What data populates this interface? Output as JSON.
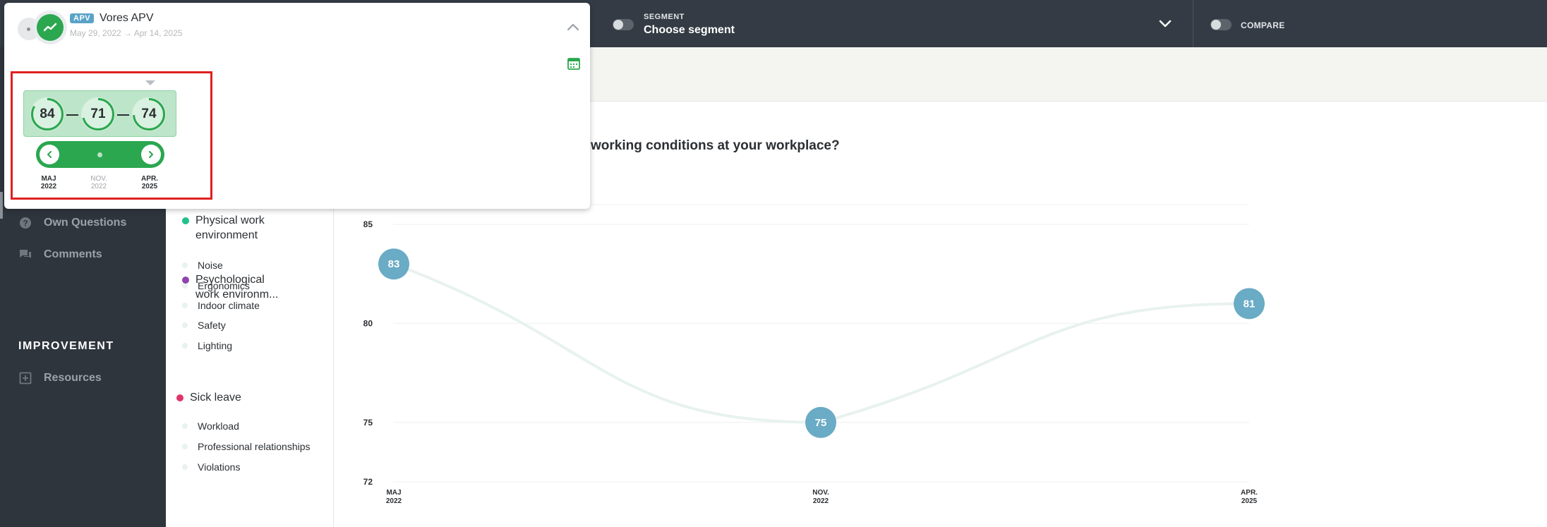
{
  "topbar": {
    "segment_label": "SEGMENT",
    "segment_value": "Choose segment",
    "compare_label": "COMPARE"
  },
  "sidebar": {
    "items": [
      {
        "label": "Own Questions",
        "icon": "question-circle-icon"
      },
      {
        "label": "Comments",
        "icon": "comments-icon"
      }
    ],
    "heading": "IMPROVEMENT",
    "improvement_items": [
      {
        "label": "Resources",
        "icon": "plus-square-icon"
      }
    ]
  },
  "main": {
    "question": "working conditions at your workplace?"
  },
  "categories": [
    {
      "label": "Physical work environment",
      "color": "#20c08a",
      "subs": [
        "Noise",
        "Ergonomics",
        "Indoor climate",
        "Safety",
        "Lighting"
      ]
    },
    {
      "label": "Psychological work environm...",
      "color": "#8e44ad",
      "subs": [
        "Workload",
        "Professional relationships",
        "Violations"
      ]
    },
    {
      "label": "Sick leave",
      "color": "#e0356a",
      "subs": []
    }
  ],
  "chart_data": {
    "type": "line",
    "x": [
      "MAJ 2022",
      "NOV. 2022",
      "APR. 2025"
    ],
    "x_ticks": [
      [
        "MAJ",
        "2022"
      ],
      [
        "NOV.",
        "2022"
      ],
      [
        "APR.",
        "2025"
      ]
    ],
    "series": [
      {
        "values": [
          83,
          75,
          81
        ]
      }
    ],
    "yticks": [
      85,
      80,
      75,
      72
    ],
    "ylim": [
      72,
      86
    ],
    "grid": true,
    "point_color": "#6aabc5",
    "line_color": "#e8f2ee"
  },
  "popup": {
    "badge": "APV",
    "title": "Vores APV",
    "dates": "May 29, 2022 → Apr 14, 2025",
    "scores": [
      84,
      71,
      74
    ],
    "nav_dates": [
      {
        "month": "MAJ",
        "year": "2022",
        "active": true
      },
      {
        "month": "NOV.",
        "year": "2022",
        "active": false
      },
      {
        "month": "APR.",
        "year": "2025",
        "active": true
      }
    ],
    "accent": "#2aa74f"
  }
}
